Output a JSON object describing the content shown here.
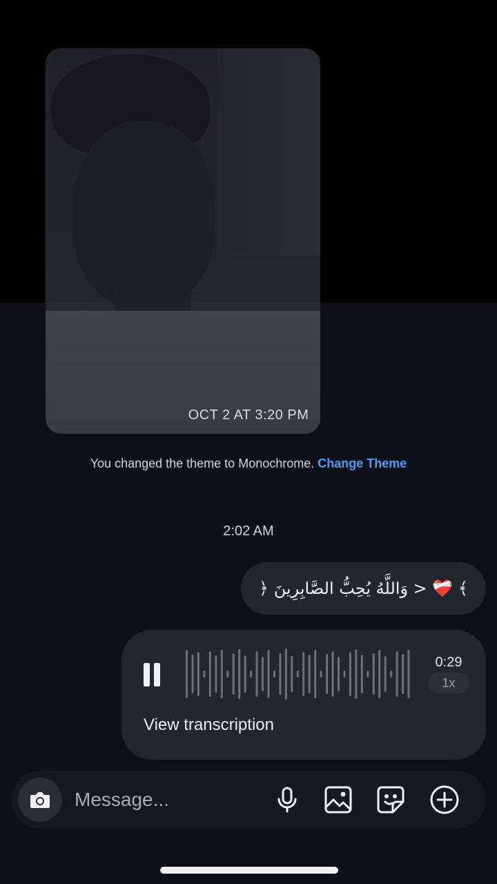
{
  "shared_photo": {
    "timestamp": "OCT 2 AT 3:20 PM"
  },
  "theme_notice": {
    "text": "You changed the theme to Monochrome.",
    "link_label": "Change Theme"
  },
  "time_separator": "2:02 AM",
  "messages": [
    {
      "type": "text",
      "text": "﴿ وَاللَّهُ يُحِبُّ الصَّابِرِينَ > ❤️‍🩹 ﴾"
    },
    {
      "type": "voice",
      "duration": "0:29",
      "speed": "1x",
      "transcription_label": "View transcription",
      "state_icon": "pause-icon"
    }
  ],
  "composer": {
    "placeholder": "Message...",
    "camera_icon": "camera-icon",
    "tool_icons": [
      "microphone-icon",
      "gallery-icon",
      "sticker-icon",
      "plus-circle-icon"
    ]
  },
  "colors": {
    "background": "#0d0f1b",
    "bubble": "#23252f",
    "link": "#4d9eef"
  }
}
